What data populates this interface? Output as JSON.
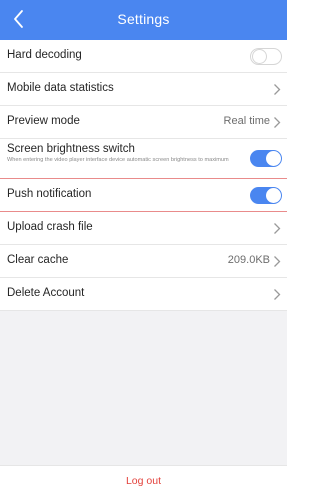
{
  "header": {
    "title": "Settings",
    "back_icon": "chevron-left-icon",
    "background_color": "#4a86f0"
  },
  "settings": {
    "hard_decoding": {
      "label": "Hard decoding",
      "enabled": false
    },
    "mobile_data_statistics": {
      "label": "Mobile data statistics",
      "icon": "chevron-right-icon"
    },
    "preview_mode": {
      "label": "Preview mode",
      "value": "Real time",
      "icon": "chevron-right-icon"
    },
    "screen_brightness": {
      "label": "Screen brightness switch",
      "description": "When entering the video player interface device automatic screen brightness to maximum",
      "enabled": true
    },
    "push_notification": {
      "label": "Push notification",
      "enabled": true
    },
    "upload_crash_file": {
      "label": "Upload crash file",
      "icon": "chevron-right-icon"
    },
    "clear_cache": {
      "label": "Clear cache",
      "value": "209.0KB",
      "icon": "chevron-right-icon"
    },
    "delete_account": {
      "label": "Delete Account",
      "icon": "chevron-right-icon"
    }
  },
  "footer": {
    "logout_label": "Log out",
    "logout_color": "#e3423c"
  },
  "colors": {
    "accent": "#4a86f0",
    "highlight_border": "#e98b8b"
  }
}
